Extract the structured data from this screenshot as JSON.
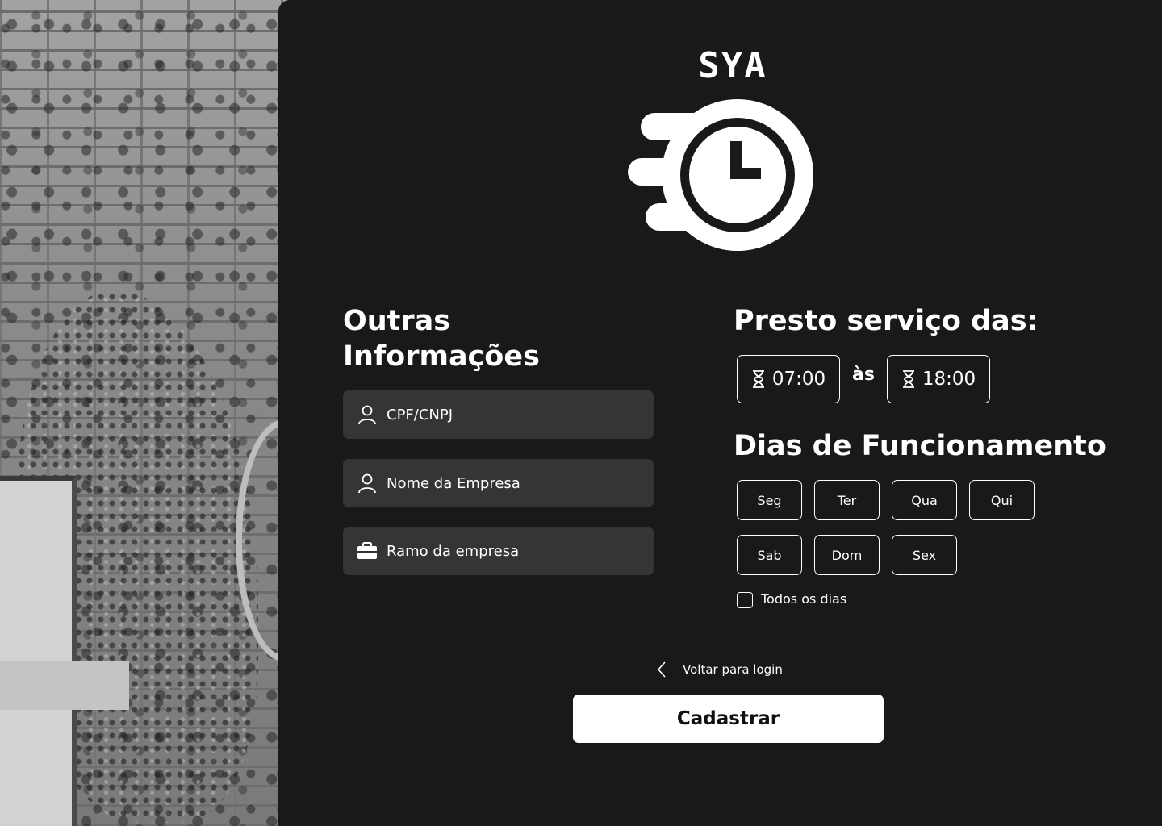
{
  "brand": {
    "name": "SYA",
    "logo_icon": "clock-speed-icon"
  },
  "other_info": {
    "title_line1": "Outras",
    "title_line2": "Informações",
    "fields": [
      {
        "placeholder": "CPF/CNPJ",
        "icon": "user-icon"
      },
      {
        "placeholder": "Nome da Empresa",
        "icon": "user-icon"
      },
      {
        "placeholder": "Ramo da empresa",
        "icon": "briefcase-icon"
      }
    ]
  },
  "service_hours": {
    "title": "Presto serviço das:",
    "start": "07:00",
    "separator": "às",
    "end": "18:00",
    "icon": "hourglass-icon"
  },
  "working_days": {
    "title": "Dias de Funcionamento",
    "days": [
      "Seg",
      "Ter",
      "Qua",
      "Qui",
      "Sab",
      "Dom",
      "Sex"
    ],
    "all_days_label": "Todos os dias",
    "all_days_checked": false
  },
  "actions": {
    "back_label": "Voltar para login",
    "submit_label": "Cadastrar"
  },
  "colors": {
    "panel_background": "#1a1818",
    "field_background": "#363535",
    "text": "#ffffff",
    "button_background": "#ffffff",
    "button_text": "#111111"
  }
}
